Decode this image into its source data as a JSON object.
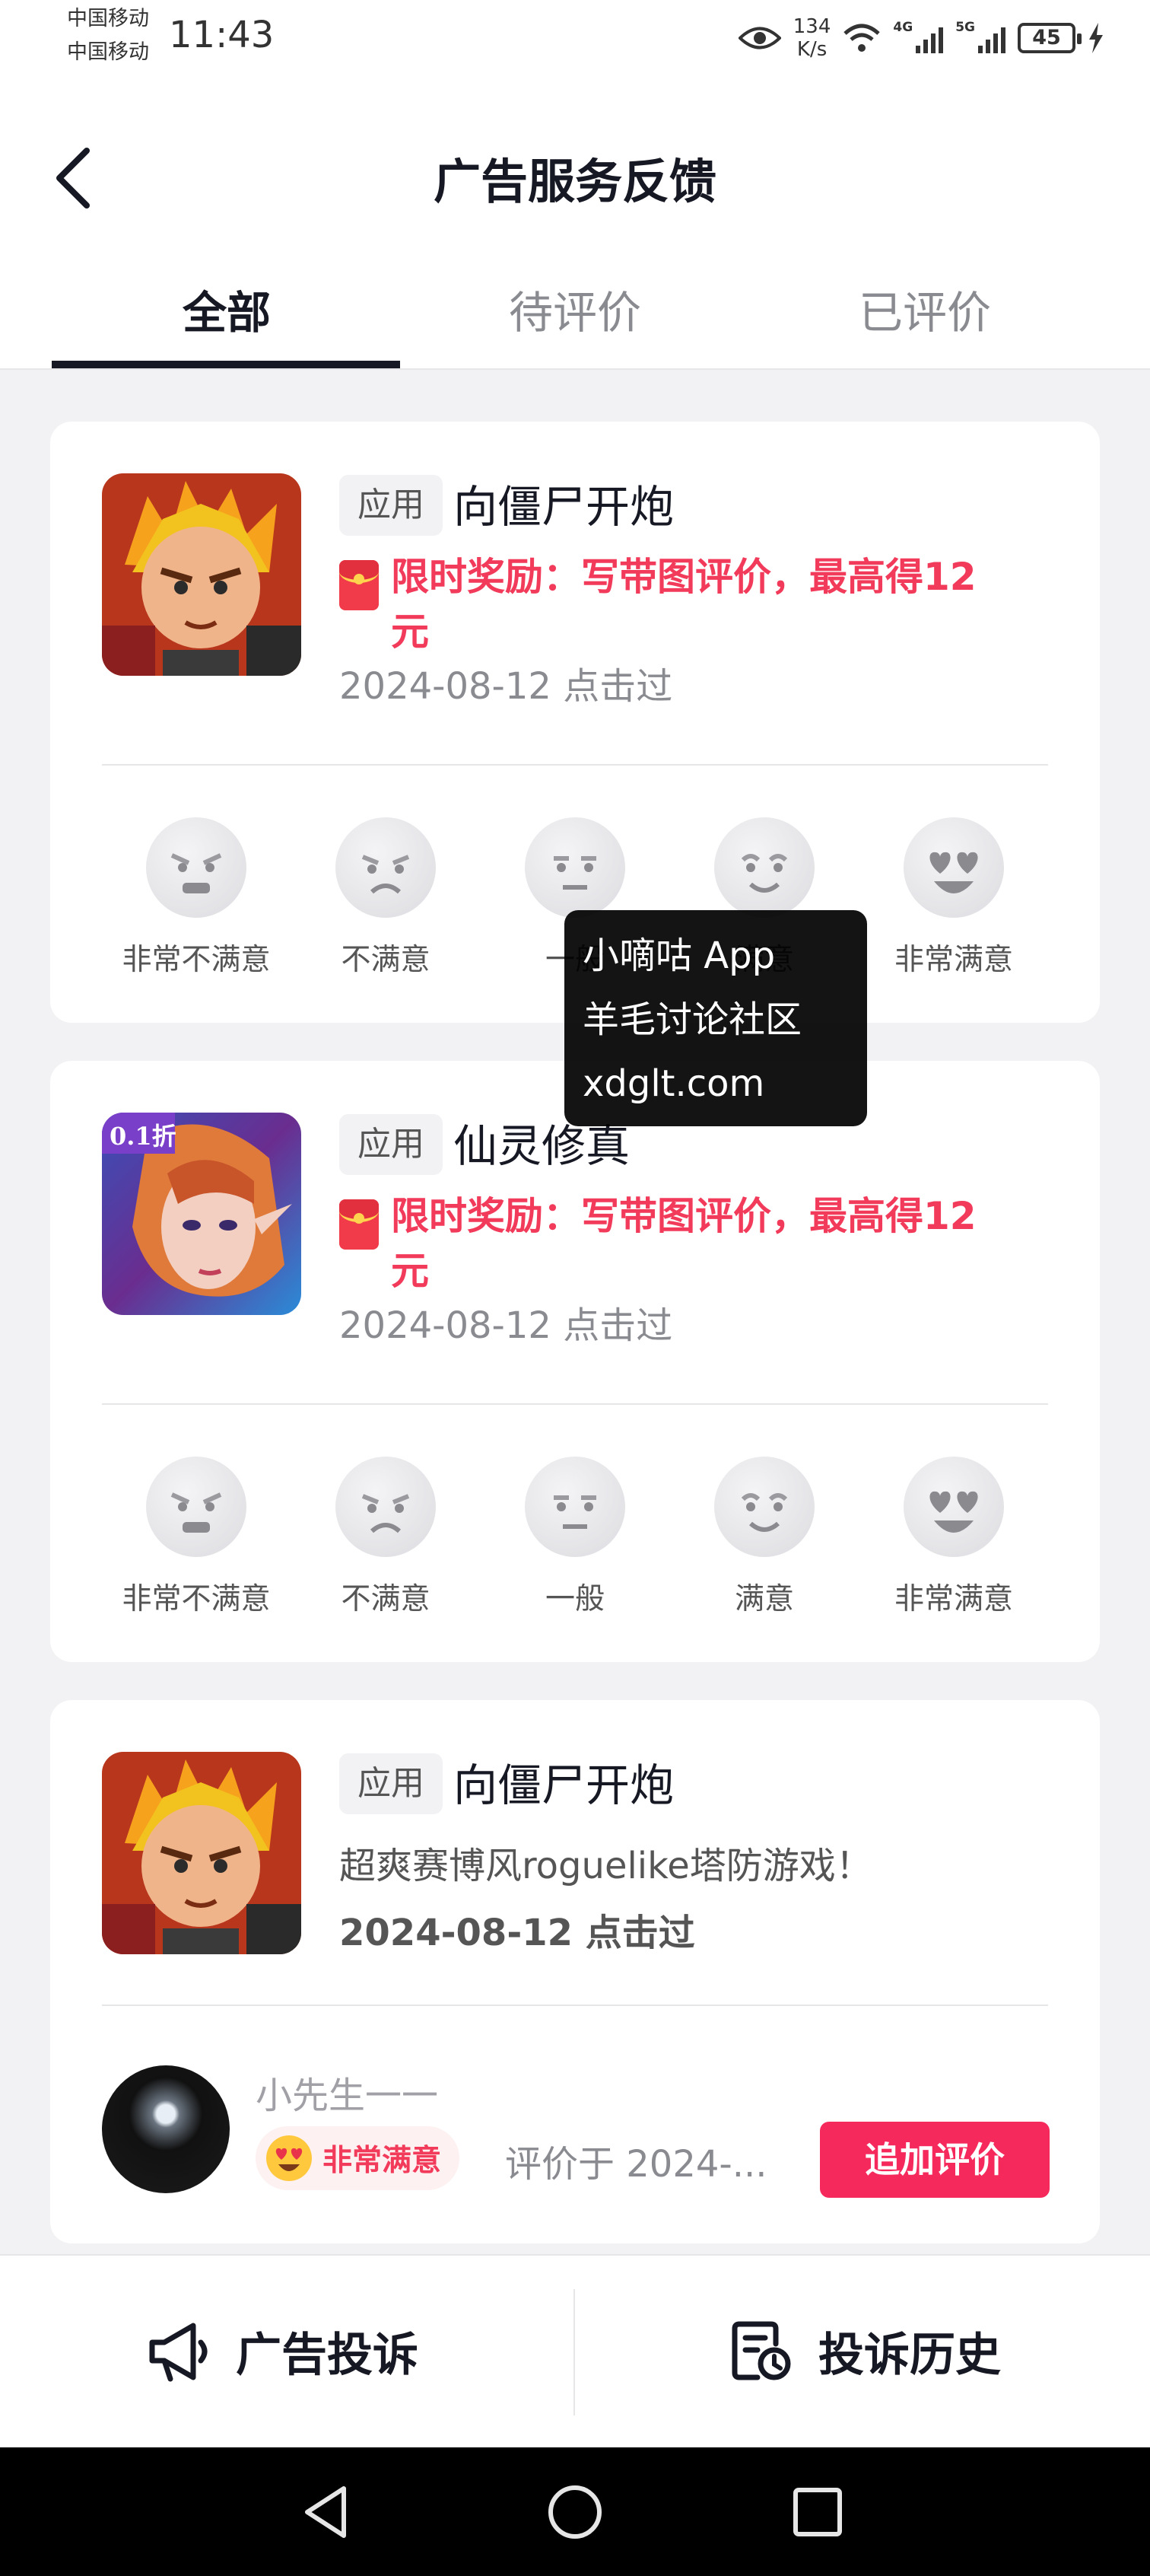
{
  "status_bar": {
    "carrier_1": "中国移动",
    "carrier_2": "中国移动",
    "time": "11:43",
    "net_speed_value": "134",
    "net_speed_unit": "K/s",
    "signal_1_label": "4G",
    "signal_2_label": "5G",
    "battery": "45",
    "icons": [
      "eye-icon",
      "wifi-icon",
      "signal-icon",
      "signal-icon",
      "battery-icon",
      "charging-icon"
    ]
  },
  "header": {
    "title": "广告服务反馈",
    "back_icon": "chevron-left-icon"
  },
  "tabs": [
    {
      "label": "全部",
      "active": true
    },
    {
      "label": "待评价",
      "active": false
    },
    {
      "label": "已评价",
      "active": false
    }
  ],
  "rating_options": [
    "非常不满意",
    "不满意",
    "一般",
    "满意",
    "非常满意"
  ],
  "cards": [
    {
      "tag": "应用",
      "name": "向僵尸开炮",
      "reward_line1": "限时奖励：写带图评价，最高得12",
      "reward_line2": "元",
      "date": "2024-08-12 点击过"
    },
    {
      "tag": "应用",
      "name": "仙灵修真",
      "icon_badge": "0.1折",
      "reward_line1": "限时奖励：写带图评价，最高得12",
      "reward_line2": "元",
      "date": "2024-08-12 点击过"
    },
    {
      "tag": "应用",
      "name": "向僵尸开炮",
      "description": "超爽赛博风roguelike塔防游戏！",
      "date": "2024-08-12 点击过",
      "reviewer": "小先生一一",
      "rating_label": "非常满意",
      "review_time": "评价于 2024-...",
      "add_review": "追加评价"
    }
  ],
  "watermark": {
    "line1": "小嘀咕 App",
    "line2": "羊毛讨论社区",
    "line3": "xdglt.com"
  },
  "bottom_bar": {
    "complaint": "广告投诉",
    "history": "投诉历史"
  },
  "colors": {
    "accent": "#f5295b",
    "reward_text": "#f23b5a",
    "page_bg": "#f2f2f4"
  }
}
